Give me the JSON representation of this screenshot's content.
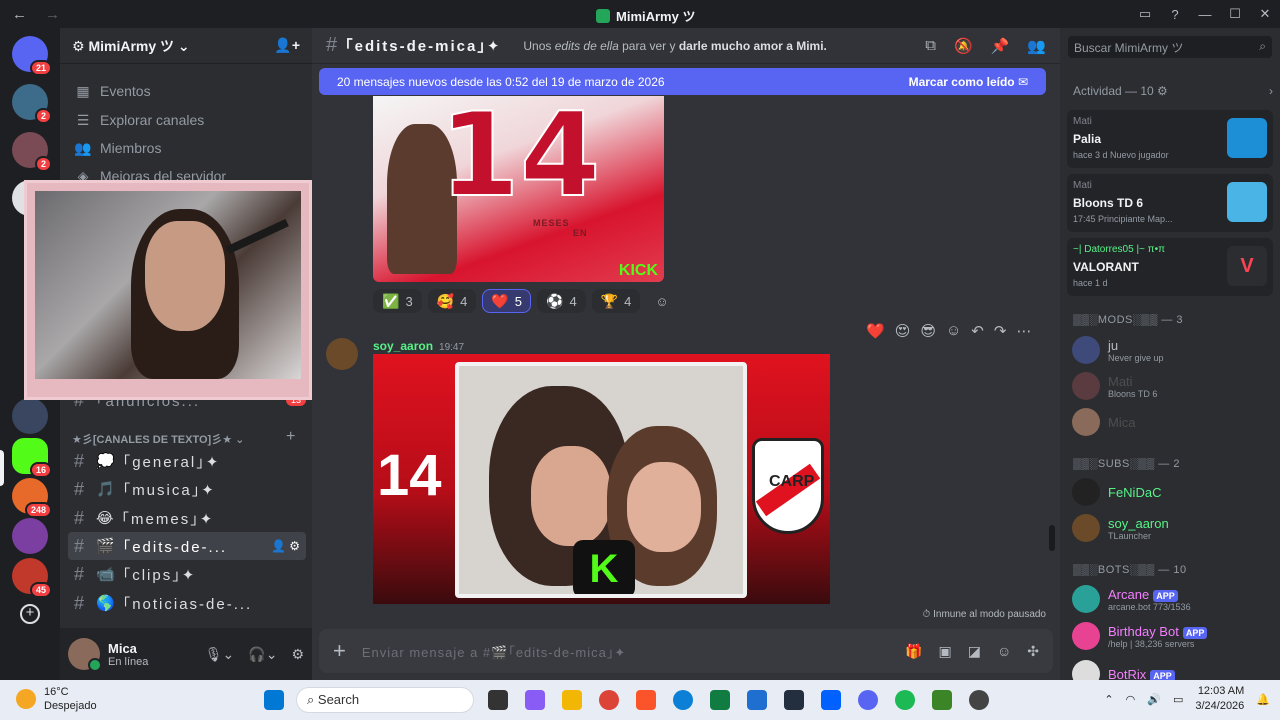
{
  "window": {
    "title": "MimiArmy ツ",
    "controls": [
      "▭",
      "?",
      "—",
      "☐",
      "✕"
    ]
  },
  "rail": {
    "badges": [
      "21",
      "2",
      "2",
      "4",
      "16",
      "248",
      "45"
    ]
  },
  "server": {
    "name": "MimiArmy ツ",
    "nav": [
      {
        "label": "Eventos",
        "icon": "calendar-icon"
      },
      {
        "label": "Explorar canales",
        "icon": "list-icon"
      },
      {
        "label": "Miembros",
        "icon": "members-icon"
      },
      {
        "label": "Mejoras del servidor",
        "icon": "boost-icon"
      }
    ],
    "anuncios": "｢anuncios...",
    "anuncios_badge": "13",
    "category": "★彡[CANALES DE TEXTO]彡★",
    "channels": [
      {
        "emoji": "💭",
        "label": "｢general｣✦"
      },
      {
        "emoji": "🎵",
        "label": "｢musica｣✦"
      },
      {
        "emoji": "😂",
        "label": "｢memes｣✦"
      },
      {
        "emoji": "🎬",
        "label": "｢edits-de-..."
      },
      {
        "emoji": "📹",
        "label": "｢clips｣✦"
      },
      {
        "emoji": "🌎",
        "label": "｢noticias-de-..."
      }
    ]
  },
  "user": {
    "name": "Mica",
    "status": "En línea"
  },
  "chat": {
    "channel_name": "｢edits-de-mica｣✦",
    "topic_prefix": "Unos ",
    "topic_italic": "edits de ella",
    "topic_middle": " para ver y ",
    "topic_bold": "darle mucho amor a Mimi.",
    "new_messages": "20 mensajes nuevos desde las 0:52 del 19 de marzo de 2026",
    "mark_read": "Marcar como leído",
    "image1": {
      "number": "14",
      "text": "MESES",
      "text2": "EN",
      "brand": "KICK"
    },
    "reactions": [
      {
        "emoji": "✅",
        "count": "3"
      },
      {
        "emoji": "🥰",
        "count": "4"
      },
      {
        "emoji": "❤️",
        "count": "5",
        "me": true
      },
      {
        "emoji": "⚽",
        "count": "4"
      },
      {
        "emoji": "🏆",
        "count": "4"
      }
    ],
    "message2": {
      "author": "soy_aaron",
      "time": "19:47"
    },
    "hover_emojis": [
      "❤️",
      "😍",
      "😎"
    ],
    "image2": {
      "number": "14",
      "crest_text": "CARP"
    },
    "immune": "Inmune al modo pausado",
    "composer_placeholder": "Enviar mensaje a #🎬｢edits-de-mica｣✦"
  },
  "members": {
    "search_placeholder": "Buscar MimiArmy ツ",
    "activity_header": "Actividad — 10",
    "activity": [
      {
        "user": "Mati",
        "game": "Palia",
        "meta": "hace 3 d   Nuevo jugador"
      },
      {
        "user": "Mati",
        "game": "Bloons TD 6",
        "meta": "17:45   Principiante Map..."
      },
      {
        "user": "~| Datorres05 |~ π•π",
        "game": "VALORANT",
        "meta": "hace 1 d"
      }
    ],
    "groups": [
      {
        "title": "▒▒░MODS░▒▒ — 3",
        "items": [
          {
            "name": "ju",
            "sub": "Never give up",
            "color": "#b5bac1"
          },
          {
            "name": "Mati",
            "sub": "Bloons TD 6",
            "color": "#4e4e4e"
          },
          {
            "name": "Mica",
            "sub": "",
            "color": "#4e4e4e"
          }
        ]
      },
      {
        "title": "▒▒░SUBS░▒▒ — 2",
        "items": [
          {
            "name": "FeNiDaC",
            "sub": "",
            "color": "#57f287"
          },
          {
            "name": "soy_aaron",
            "sub": "TLauncher",
            "color": "#57f287"
          }
        ]
      },
      {
        "title": "▒▒░BOTS░▒▒ — 10",
        "items": [
          {
            "name": "Arcane",
            "sub": "arcane.bot 773/1536",
            "color": "#f47fff",
            "app": "APP"
          },
          {
            "name": "Birthday Bot",
            "sub": "/help | 38,236 servers",
            "color": "#f47fff",
            "app": "APP"
          },
          {
            "name": "BotRix",
            "sub": "",
            "color": "#f47fff",
            "app": "APP"
          }
        ]
      }
    ]
  },
  "taskbar": {
    "temp": "16°C",
    "weather": "Despejado",
    "search": "Search",
    "time": "12:03 AM",
    "date": "3/24/2026"
  }
}
